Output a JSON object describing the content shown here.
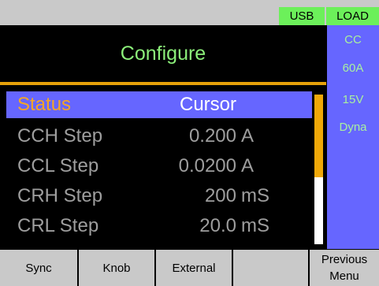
{
  "topbar": {
    "usb": "USB",
    "load": "LOAD"
  },
  "title": "Configure",
  "side_panel": [
    "CC",
    "60A",
    "15V",
    "Dyna"
  ],
  "list": {
    "rows": [
      {
        "label": "Status",
        "value": "Cursor",
        "unit": "",
        "selected": true
      },
      {
        "label": "CCH Step",
        "value": "0.200",
        "unit": "A",
        "selected": false
      },
      {
        "label": "CCL Step",
        "value": "0.0200",
        "unit": "A",
        "selected": false
      },
      {
        "label": "CRH Step",
        "value": "200",
        "unit": "mS",
        "selected": false
      },
      {
        "label": "CRL Step",
        "value": "20.0",
        "unit": "mS",
        "selected": false
      }
    ],
    "scroll_position": 0.55
  },
  "softkeys": {
    "k1": "Sync",
    "k2": "Knob",
    "k3": "External",
    "k4": "",
    "k5_line1": "Previous",
    "k5_line2": "Menu"
  },
  "colors": {
    "accent_green": "#6cf05a",
    "panel_blue": "#6666ff",
    "selection_orange": "#f5a623",
    "title_green": "#8cf07a"
  }
}
